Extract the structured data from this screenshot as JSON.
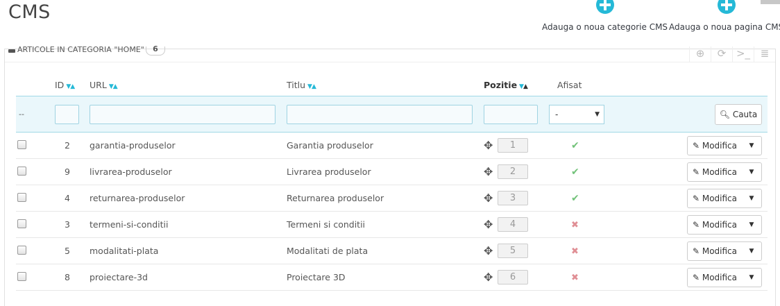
{
  "header": {
    "title": "CMS",
    "add_category_label": "Adauga o noua categorie CMS",
    "add_page_label": "Adauga o noua pagina CMS"
  },
  "panel": {
    "heading": "Articole in categoria \"Home\"",
    "count": "6"
  },
  "table": {
    "columns": {
      "id": "ID",
      "url": "URL",
      "title": "Titlu",
      "position": "Pozitie",
      "displayed": "Afisat"
    },
    "filter": {
      "bulk_placeholder": "--",
      "displayed_selected": "-",
      "search_label": "Cauta"
    },
    "rows": [
      {
        "id": "2",
        "url": "garantia-produselor",
        "title": "Garantia produselor",
        "position": "1",
        "displayed": true
      },
      {
        "id": "9",
        "url": "livrarea-produselor",
        "title": "Livrarea produselor",
        "position": "2",
        "displayed": true
      },
      {
        "id": "4",
        "url": "returnarea-produselor",
        "title": "Returnarea produselor",
        "position": "3",
        "displayed": true
      },
      {
        "id": "3",
        "url": "termeni-si-conditii",
        "title": "Termeni si conditii",
        "position": "4",
        "displayed": false
      },
      {
        "id": "5",
        "url": "modalitati-plata",
        "title": "Modalitati de plata",
        "position": "5",
        "displayed": false
      },
      {
        "id": "8",
        "url": "proiectare-3d",
        "title": "Proiectare 3D",
        "position": "6",
        "displayed": false
      }
    ],
    "edit_label": "Modifica"
  },
  "colors": {
    "accent": "#25b9d7",
    "yes": "#72c279",
    "no": "#e08f95"
  }
}
